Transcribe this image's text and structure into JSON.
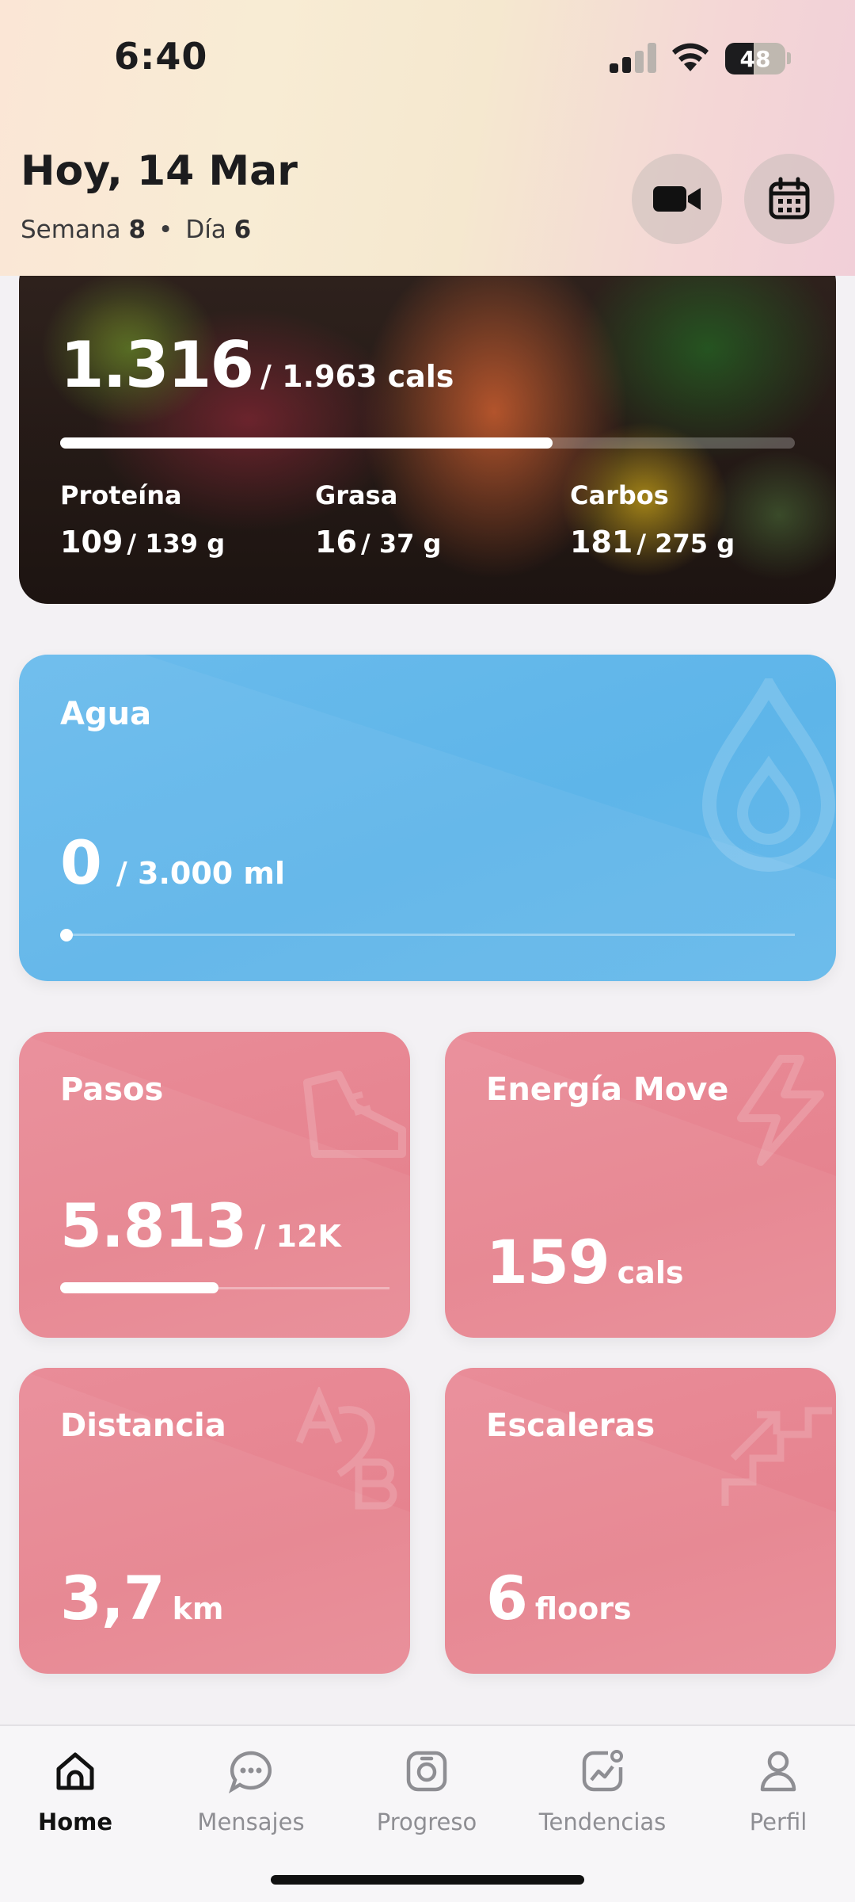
{
  "status_bar": {
    "time": "6:40",
    "battery": "48"
  },
  "header": {
    "date_title": "Hoy, 14 Mar",
    "week_label": "Semana",
    "week_value": "8",
    "separator": "•",
    "day_label": "Día",
    "day_value": "6",
    "video_icon": "video-camera-icon",
    "calendar_icon": "calendar-icon"
  },
  "calories": {
    "current": "1.316",
    "goal": "/ 1.963 cals",
    "progress": 0.67,
    "macros": [
      {
        "label": "Proteína",
        "value": "109",
        "goal": "/ 139 g"
      },
      {
        "label": "Grasa",
        "value": "16",
        "goal": "/ 37 g"
      },
      {
        "label": "Carbos",
        "value": "181",
        "goal": "/ 275 g"
      }
    ]
  },
  "water": {
    "title": "Agua",
    "value": "0",
    "goal": "/  3.000 ml",
    "progress": 0,
    "icon": "water-drop-icon"
  },
  "steps": {
    "title": "Pasos",
    "value": "5.813",
    "goal": "/ 12K",
    "progress": 0.48,
    "icon": "shoe-icon"
  },
  "energy": {
    "title": "Energía Move",
    "value": "159",
    "unit": "cals",
    "icon": "lightning-icon"
  },
  "distance": {
    "title": "Distancia",
    "value": "3,7",
    "unit": "km",
    "icon": "a-to-b-icon"
  },
  "stairs": {
    "title": "Escaleras",
    "value": "6",
    "unit": "floors",
    "icon": "stairs-icon"
  },
  "nav": {
    "items": [
      {
        "label": "Home",
        "icon": "home-icon",
        "active": true
      },
      {
        "label": "Mensajes",
        "icon": "chat-icon",
        "active": false
      },
      {
        "label": "Progreso",
        "icon": "scale-icon",
        "active": false
      },
      {
        "label": "Tendencias",
        "icon": "trend-chart-icon",
        "active": false
      },
      {
        "label": "Perfil",
        "icon": "user-icon",
        "active": false
      }
    ]
  },
  "colors": {
    "water_card": "#62b7ea",
    "activity_card": "#e7878f",
    "nav_active": "#111111",
    "nav_inactive": "#8e8e93"
  }
}
